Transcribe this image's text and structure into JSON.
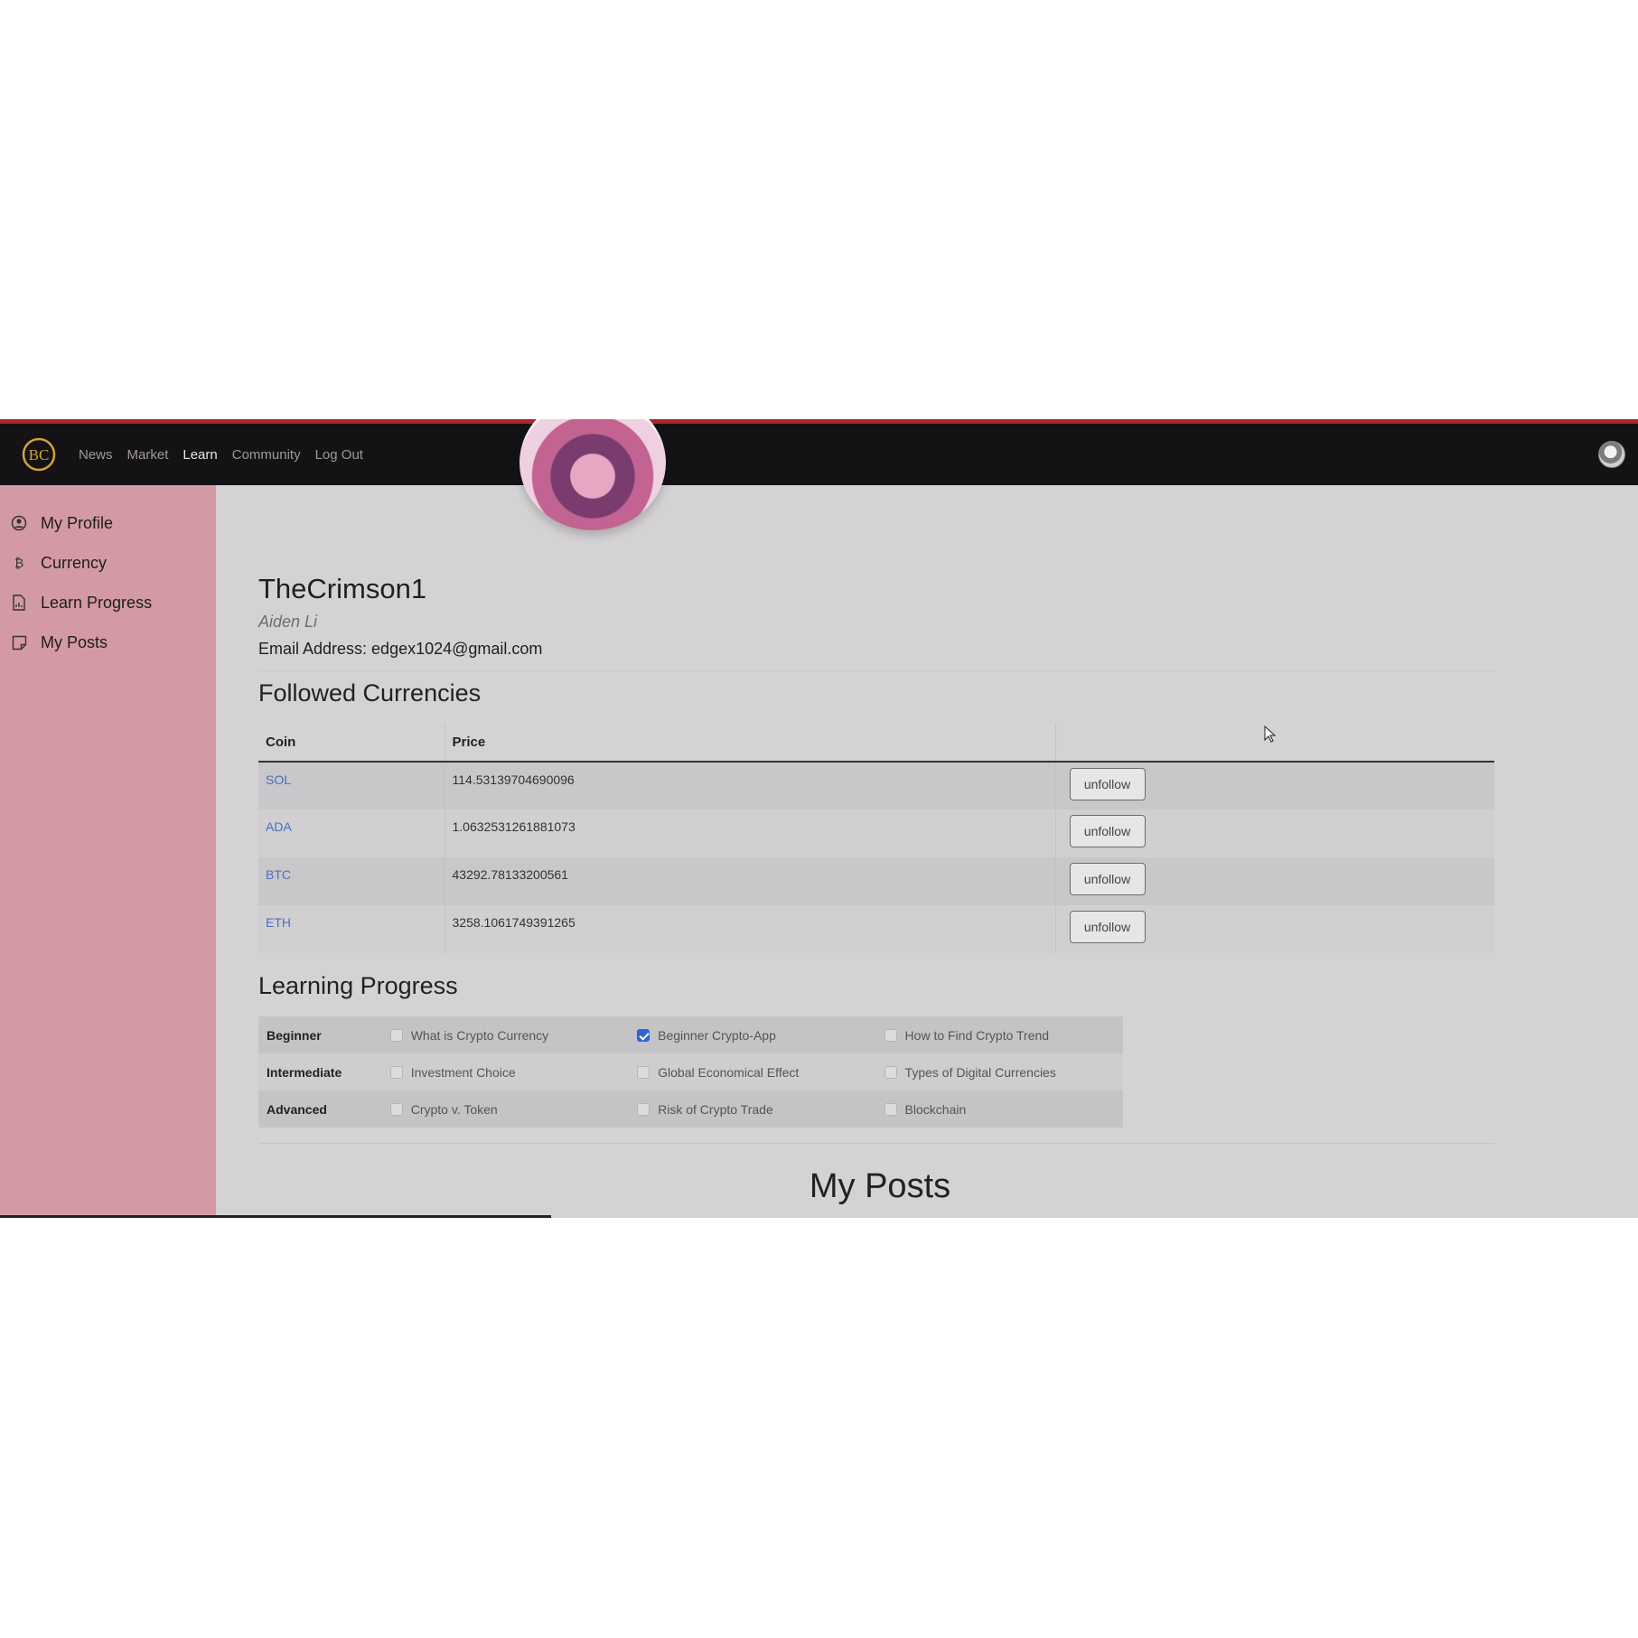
{
  "navbar": {
    "logo_text": "BC",
    "links": [
      {
        "label": "News"
      },
      {
        "label": "Market"
      },
      {
        "label": "Learn"
      },
      {
        "label": "Community"
      },
      {
        "label": "Log Out"
      }
    ]
  },
  "sidebar": {
    "items": [
      {
        "label": "My Profile",
        "icon": "user-circle-icon"
      },
      {
        "label": "Currency",
        "icon": "bitcoin-icon"
      },
      {
        "label": "Learn Progress",
        "icon": "document-chart-icon"
      },
      {
        "label": "My Posts",
        "icon": "sticky-note-icon"
      }
    ]
  },
  "profile": {
    "username": "TheCrimson1",
    "full_name": "Aiden Li",
    "email_line": "Email Address: edgex1024@gmail.com"
  },
  "followed": {
    "title": "Followed Currencies",
    "columns": [
      "Coin",
      "Price",
      ""
    ],
    "rows": [
      {
        "coin": "SOL",
        "price": "114.53139704690096",
        "action": "unfollow"
      },
      {
        "coin": "ADA",
        "price": "1.0632531261881073",
        "action": "unfollow"
      },
      {
        "coin": "BTC",
        "price": "43292.78133200561",
        "action": "unfollow"
      },
      {
        "coin": "ETH",
        "price": "3258.1061749391265",
        "action": "unfollow"
      }
    ]
  },
  "learning": {
    "title": "Learning Progress",
    "rows": [
      {
        "level": "Beginner",
        "items": [
          {
            "label": "What is Crypto Currency",
            "checked": false
          },
          {
            "label": "Beginner Crypto-App",
            "checked": true
          },
          {
            "label": "How to Find Crypto Trend",
            "checked": false
          }
        ]
      },
      {
        "level": "Intermediate",
        "items": [
          {
            "label": "Investment Choice",
            "checked": false
          },
          {
            "label": "Global Economical Effect",
            "checked": false
          },
          {
            "label": "Types of Digital Currencies",
            "checked": false
          }
        ]
      },
      {
        "level": "Advanced",
        "items": [
          {
            "label": "Crypto v. Token",
            "checked": false
          },
          {
            "label": "Risk of Crypto Trade",
            "checked": false
          },
          {
            "label": "Blockchain",
            "checked": false
          }
        ]
      }
    ]
  },
  "posts": {
    "title": "My Posts"
  },
  "colors": {
    "navbar_bg": "#141214",
    "accent_red": "#b4242b",
    "sidebar_bg": "#d49aa3",
    "content_bg": "#d4d2d4",
    "link_blue": "#4a6fc3",
    "checkbox_blue": "#2d64d8",
    "logo_gold": "#d0a43a"
  }
}
